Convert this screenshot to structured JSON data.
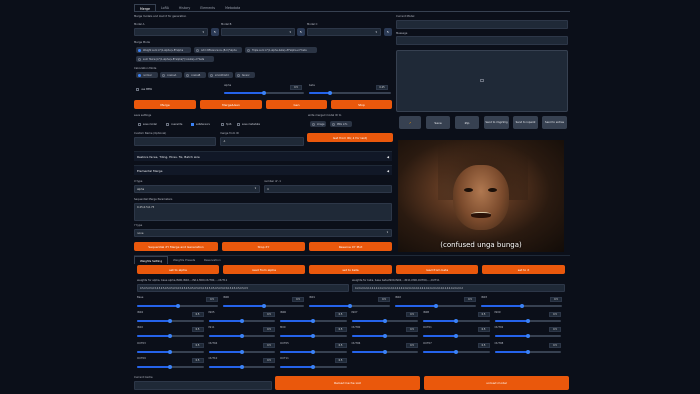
{
  "tabs": [
    "Merge",
    "LoRA",
    "History",
    "Elements",
    "Metadata"
  ],
  "header_note": "Merge models and load it for generation",
  "model_a": {
    "label": "Model A"
  },
  "model_b": {
    "label": "Model B"
  },
  "model_c": {
    "label": "Model C"
  },
  "merge_mode": {
    "label": "Merge Mode",
    "options": [
      "Weight sum:A*(1-alpha)+B*alpha",
      "Add difference:A+(B-C)*alpha",
      "Triple sum:A*(1-alpha-beta)+B*alpha+C*beta",
      "sum Twice:(A*(1-alpha)+B*alpha)*(1-beta)+C*beta"
    ],
    "selected": 0
  },
  "calc_mode": {
    "label": "Calculation Mode",
    "options": [
      "normal",
      "cosineA",
      "cosineB",
      "smoothAdd",
      "tensor"
    ],
    "selected": 0
  },
  "use_mbw": "use MBW",
  "alpha": {
    "label": "alpha",
    "value": "0.5",
    "fraction": 0.5
  },
  "beta": {
    "label": "beta",
    "value": "0.25",
    "fraction": 0.25
  },
  "buttons": {
    "merge": "Merge",
    "merge_gen": "Merge&Gen",
    "gen": "Gen",
    "stop": "Stop"
  },
  "save_settings": {
    "label": "save settings",
    "options": [
      "save model",
      "overwrite",
      "safetensors",
      "fp16",
      "save metadata"
    ],
    "checked": [
      false,
      false,
      true,
      false,
      false
    ]
  },
  "write_merged": {
    "label": "write merged model ID to",
    "options": [
      "image",
      "PNG info"
    ]
  },
  "custom_name": {
    "label": "Custom Name (Optional)"
  },
  "merge_from_id": {
    "label": "merge from ID",
    "value": "-1"
  },
  "get_from_id_button": "Get from ID(-1 for last)",
  "restore_faces": "Restore faces, Tiling, Hires. fix, Batch size",
  "elemental_merge": "Elemental Merge",
  "x_type": {
    "label": "X type",
    "value": "alpha"
  },
  "num_x": {
    "label": "number of -1",
    "value": "4"
  },
  "seq_merge": {
    "label": "Sequential Merge Parameters",
    "value": "0.25,0.5,0.75"
  },
  "y_type": {
    "label": "Y type",
    "value": "none"
  },
  "seq_buttons": {
    "seq": "Sequential XY Merge and Generation",
    "stop": "Stop XY",
    "reserve": "Reserve XY Plot"
  },
  "right": {
    "current_model": "Current Model",
    "message": "Message",
    "send_buttons": [
      "↗",
      "Save",
      "Zip",
      "Send to img2img",
      "Send to inpaint",
      "Send to extras"
    ],
    "caption": "(confused unga bunga)"
  },
  "weights_tabs": [
    "Weights Setting",
    "Weights Presets",
    "Reservation"
  ],
  "weights_buttons": [
    "set to alpha",
    "read from alpha",
    "set to beta",
    "read from beta",
    "set to X"
  ],
  "weights_alpha_label": "weights for alpha, base alpha,IN00,IN02,...IN11,M00,OUT00,...,OUT11",
  "weights_alpha_value": "0.5,0.5,0.5,0.5,0.5,0.5,0.5,0.5,0.5,0.5,0.5,0.5,0.5,0.5,0.5,0.5,0.5,0.5,0.5,0.5,0.5,0.5,0.5,0.5,0.5,0.5",
  "weights_beta_label": "weights,for beta, base beta,IN00,IN02,...IN11,M00,OUT00,...,OUT11",
  "weights_beta_value": "0.2,0.2,0.2,0.2,0.2,0.2,0.2,0.2,0.2,0.2,0.2,0.2,0.2,0.2,0.2,0.2,0.2,0.2,0.2,0.2,0.2,0.2,0.2,0.2,0.2,0.2",
  "block_rows": [
    [
      {
        "n": "Base",
        "v": "0.5"
      },
      {
        "n": "IN00",
        "v": "0.5"
      },
      {
        "n": "IN01",
        "v": "0.5"
      },
      {
        "n": "IN02",
        "v": "0.5"
      },
      {
        "n": "IN03",
        "v": "0.5"
      }
    ],
    [
      {
        "n": "IN04",
        "v": "0.5"
      },
      {
        "n": "IN05",
        "v": "0.5"
      },
      {
        "n": "IN06",
        "v": "0.5"
      },
      {
        "n": "IN07",
        "v": "0.5"
      },
      {
        "n": "IN08",
        "v": "0.5"
      },
      {
        "n": "IN09",
        "v": "0.5"
      }
    ],
    [
      {
        "n": "IN10",
        "v": "0.5"
      },
      {
        "n": "IN11",
        "v": "0.5"
      },
      {
        "n": "M00",
        "v": "0.5"
      },
      {
        "n": "OUT00",
        "v": "0.5"
      },
      {
        "n": "OUT01",
        "v": "0.5"
      },
      {
        "n": "OUT02",
        "v": "0.5"
      }
    ],
    [
      {
        "n": "OUT03",
        "v": "0.5"
      },
      {
        "n": "OUT04",
        "v": "0.5"
      },
      {
        "n": "OUT05",
        "v": "0.5"
      },
      {
        "n": "OUT06",
        "v": "0.5"
      },
      {
        "n": "OUT07",
        "v": "0.5"
      },
      {
        "n": "OUT08",
        "v": "0.5"
      }
    ],
    [
      {
        "n": "OUT09",
        "v": "0.5"
      },
      {
        "n": "OUT10",
        "v": "0.5"
      },
      {
        "n": "OUT11",
        "v": "0.5"
      }
    ]
  ],
  "current_cache": "Current Cache",
  "reload_cache": "Reload Cache List",
  "unload_model": "unload model"
}
